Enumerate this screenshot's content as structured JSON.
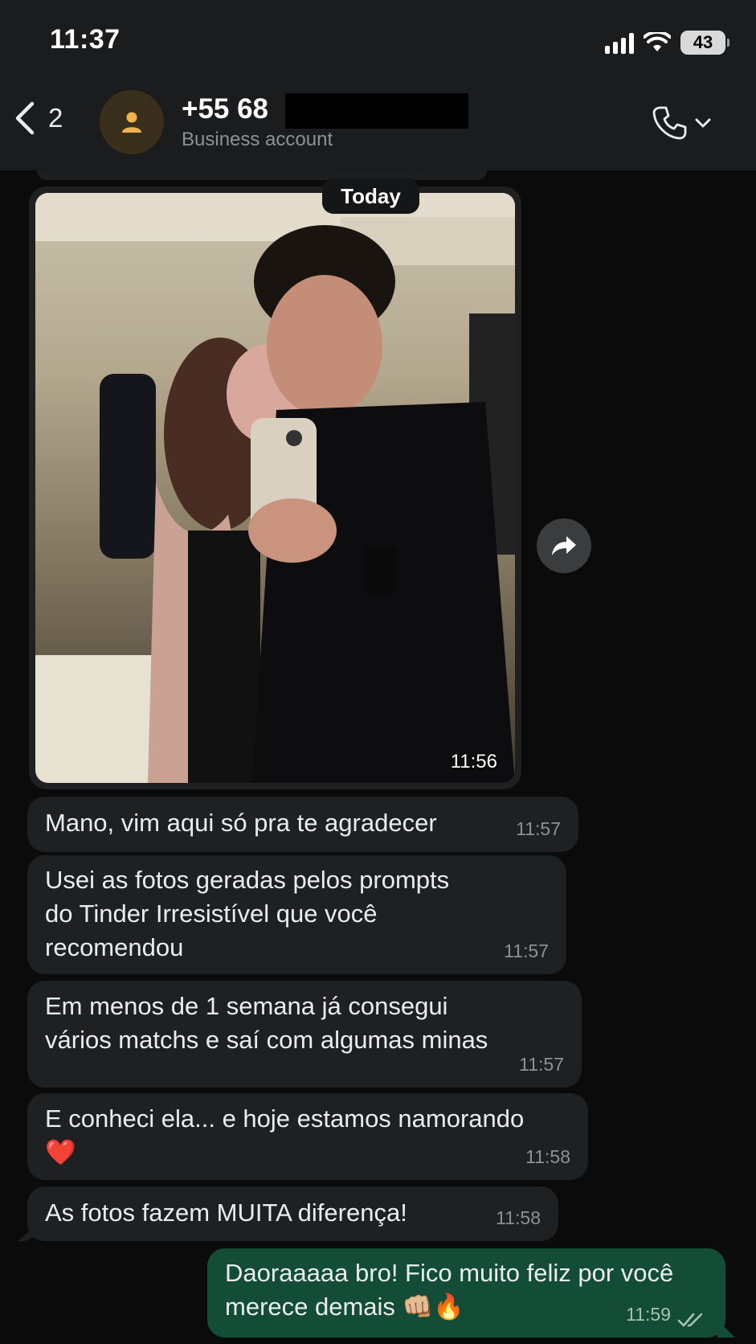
{
  "status_bar": {
    "time": "11:37",
    "battery": "43"
  },
  "header": {
    "back_count": "2",
    "contact_number": "+55 68",
    "contact_subtitle": "Business account",
    "icons": {
      "back": "chevron-left-icon",
      "avatar": "person-icon",
      "call": "phone-icon",
      "menu": "chevron-down-icon"
    }
  },
  "chat": {
    "date_separator": "Today",
    "image_message": {
      "time": "11:56",
      "icon": "forward-icon"
    },
    "incoming": [
      {
        "text": "Mano, vim aqui só pra te agradecer",
        "time": "11:57"
      },
      {
        "text": "Usei as fotos geradas pelos prompts\ndo Tinder Irresistível que você\nrecomendou",
        "time": "11:57"
      },
      {
        "text": "Em menos de 1 semana já consegui\nvários matchs e saí com algumas minas",
        "time": "11:57"
      },
      {
        "text": "E conheci ela... e hoje estamos namorando\n❤️",
        "time": "11:58"
      },
      {
        "text": "As fotos fazem MUITA diferença!",
        "time": "11:58"
      }
    ],
    "outgoing": [
      {
        "text": "Daoraaaaa bro! Fico muito feliz por você\nmerece demais 👊🏼🔥",
        "time": "11:59",
        "status": "read"
      }
    ]
  },
  "colors": {
    "background": "#0b0b0c",
    "header": "#1b1c1d",
    "incoming_bubble": "#1f2021",
    "outgoing_bubble": "#144d37",
    "timestamp": "#8e9194"
  }
}
